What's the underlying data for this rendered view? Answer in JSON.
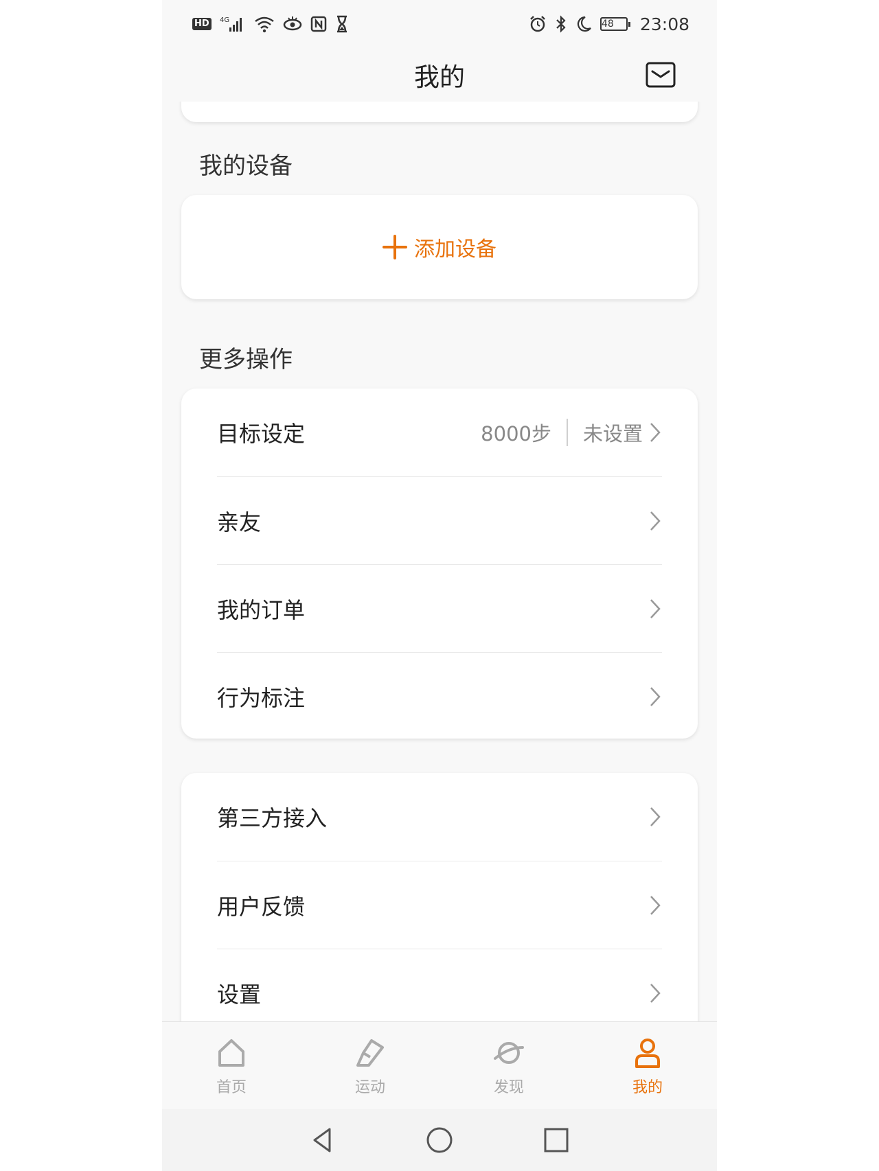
{
  "status_bar": {
    "hd": "HD",
    "network": "4G",
    "battery": "48",
    "time": "23:08",
    "left_icons": [
      "hd-icon",
      "signal-icon",
      "wifi-icon",
      "eye-comfort-icon",
      "nfc-icon",
      "hourglass-icon"
    ],
    "right_icons": [
      "alarm-icon",
      "bluetooth-icon",
      "moon-icon",
      "battery-icon"
    ]
  },
  "header": {
    "title": "我的"
  },
  "devices": {
    "section_label": "我的设备",
    "add_label": "添加设备"
  },
  "more": {
    "section_label": "更多操作",
    "goal": {
      "label": "目标设定",
      "steps": "8000步",
      "status": "未设置"
    },
    "items": [
      {
        "label": "亲友"
      },
      {
        "label": "我的订单"
      },
      {
        "label": "行为标注"
      }
    ]
  },
  "more2": {
    "items": [
      {
        "label": "第三方接入"
      },
      {
        "label": "用户反馈"
      },
      {
        "label": "设置"
      }
    ]
  },
  "bottom_nav": {
    "items": [
      {
        "label": "首页",
        "icon": "home-icon",
        "active": false
      },
      {
        "label": "运动",
        "icon": "shoe-icon",
        "active": false
      },
      {
        "label": "发现",
        "icon": "planet-icon",
        "active": false
      },
      {
        "label": "我的",
        "icon": "person-icon",
        "active": true
      }
    ]
  },
  "colors": {
    "accent": "#e8720c",
    "text": "#222222",
    "muted": "#888888"
  }
}
